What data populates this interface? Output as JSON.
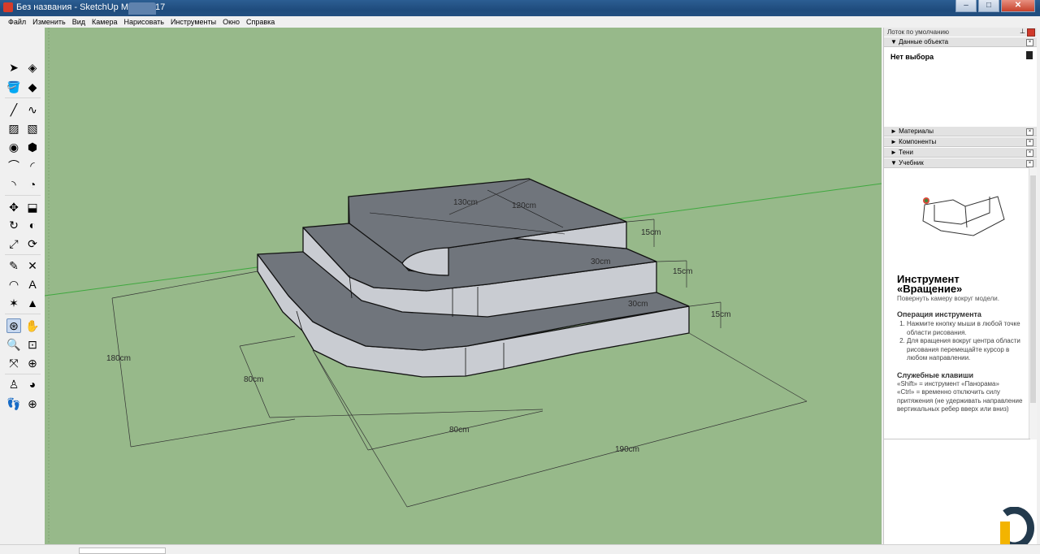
{
  "window": {
    "title": "Без названия - SketchUp Make 2017",
    "minimize": "–",
    "maximize": "□",
    "close": "✕"
  },
  "menu": [
    "Файл",
    "Изменить",
    "Вид",
    "Камера",
    "Нарисовать",
    "Инструменты",
    "Окно",
    "Справка"
  ],
  "toolbar": {
    "tools": [
      {
        "name": "select-tool-icon",
        "glyph": "➤"
      },
      {
        "name": "make-component-icon",
        "glyph": "◈"
      },
      {
        "name": "paint-bucket-icon",
        "glyph": "🪣"
      },
      {
        "name": "eraser-icon",
        "glyph": "◆"
      },
      {
        "name": "line-tool-icon",
        "glyph": "╱"
      },
      {
        "name": "freehand-icon",
        "glyph": "∿"
      },
      {
        "name": "rectangle-icon",
        "glyph": "▨"
      },
      {
        "name": "rotated-rectangle-icon",
        "glyph": "▧"
      },
      {
        "name": "circle-icon",
        "glyph": "◉"
      },
      {
        "name": "polygon-icon",
        "glyph": "⬢"
      },
      {
        "name": "arc-icon",
        "glyph": "⌒"
      },
      {
        "name": "two-point-arc-icon",
        "glyph": "◜"
      },
      {
        "name": "three-point-arc-icon",
        "glyph": "◝"
      },
      {
        "name": "pie-icon",
        "glyph": "◔"
      },
      {
        "name": "move-icon",
        "glyph": "✥"
      },
      {
        "name": "push-pull-icon",
        "glyph": "⬓"
      },
      {
        "name": "rotate-icon",
        "glyph": "↻"
      },
      {
        "name": "follow-me-icon",
        "glyph": "◐"
      },
      {
        "name": "scale-icon",
        "glyph": "⤢"
      },
      {
        "name": "offset-icon",
        "glyph": "⟳"
      },
      {
        "name": "tape-measure-icon",
        "glyph": "✎"
      },
      {
        "name": "dimension-icon",
        "glyph": "✕"
      },
      {
        "name": "protractor-icon",
        "glyph": "◠"
      },
      {
        "name": "text-icon",
        "glyph": "A"
      },
      {
        "name": "axes-icon",
        "glyph": "✶"
      },
      {
        "name": "3d-text-icon",
        "glyph": "▲"
      },
      {
        "name": "orbit-icon",
        "glyph": "⊛"
      },
      {
        "name": "pan-icon",
        "glyph": "✋"
      },
      {
        "name": "zoom-icon",
        "glyph": "🔍"
      },
      {
        "name": "zoom-window-icon",
        "glyph": "⊡"
      },
      {
        "name": "zoom-extents-icon",
        "glyph": "⤧"
      },
      {
        "name": "previous-view-icon",
        "glyph": "⊕"
      },
      {
        "name": "position-camera-icon",
        "glyph": "♙"
      },
      {
        "name": "look-around-icon",
        "glyph": "◕"
      },
      {
        "name": "walk-icon",
        "glyph": "👣"
      },
      {
        "name": "section-plane-icon",
        "glyph": "⊕"
      }
    ]
  },
  "viewport": {
    "background": "#97b98a",
    "dimensions": [
      "130cm",
      "120cm",
      "15cm",
      "30cm",
      "15cm",
      "30cm",
      "15cm",
      "180cm",
      "80cm",
      "80cm",
      "190cm"
    ]
  },
  "tray": {
    "title": "Лоток по умолчанию",
    "pin": "⊥",
    "entity_info": {
      "header": "▼ Данные объекта",
      "no_selection": "Нет выбора"
    },
    "panels": [
      "► Материалы",
      "► Компоненты",
      "► Тени",
      "▼ Учебник"
    ],
    "tutorial": {
      "title": "Инструмент «Вращение»",
      "subtitle": "Повернуть камеру вокруг модели.",
      "operation_heading": "Операция инструмента",
      "steps": [
        "Нажмите кнопку мыши в любой точке области рисования.",
        "Для вращения вокруг центра области рисования перемещайте курсор в любом направлении."
      ],
      "keys_heading": "Служебные клавиши",
      "keys_text": "«Shift» = инструмент «Панорама»\n«Ctrl» = временно отключить силу притяжения (не удерживать направление вертикальных ребер вверх или вниз)"
    }
  }
}
